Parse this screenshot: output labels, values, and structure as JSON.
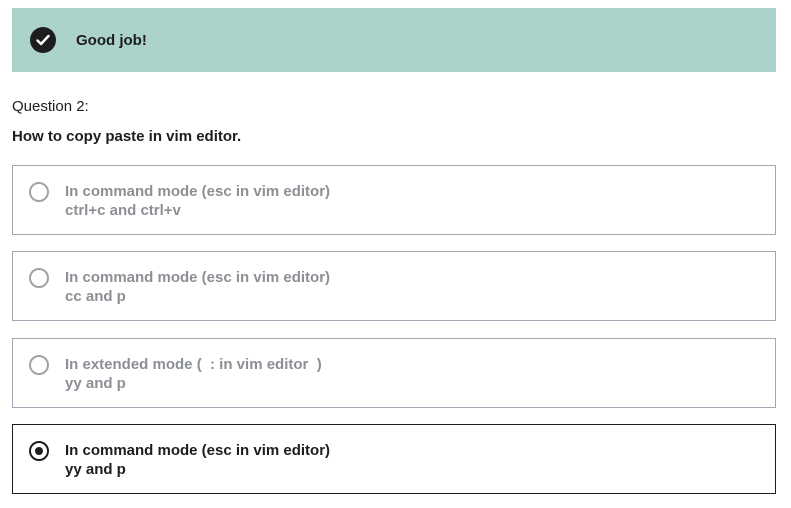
{
  "banner": {
    "icon": "check-circle-icon",
    "text": "Good job!",
    "color": "#acd2cc"
  },
  "question": {
    "number_label": "Question 2:",
    "text": "How to copy paste in vim editor."
  },
  "options": [
    {
      "line1": "In command mode (esc in vim editor)",
      "line2": "ctrl+c and ctrl+v",
      "selected": false
    },
    {
      "line1": "In command mode (esc in vim editor)",
      "line2": "cc and p",
      "selected": false
    },
    {
      "line1": "In extended mode (  : in vim editor  )",
      "line2": "yy and p",
      "selected": false
    },
    {
      "line1": "In command mode (esc in vim editor)",
      "line2": "yy and p",
      "selected": true
    }
  ]
}
